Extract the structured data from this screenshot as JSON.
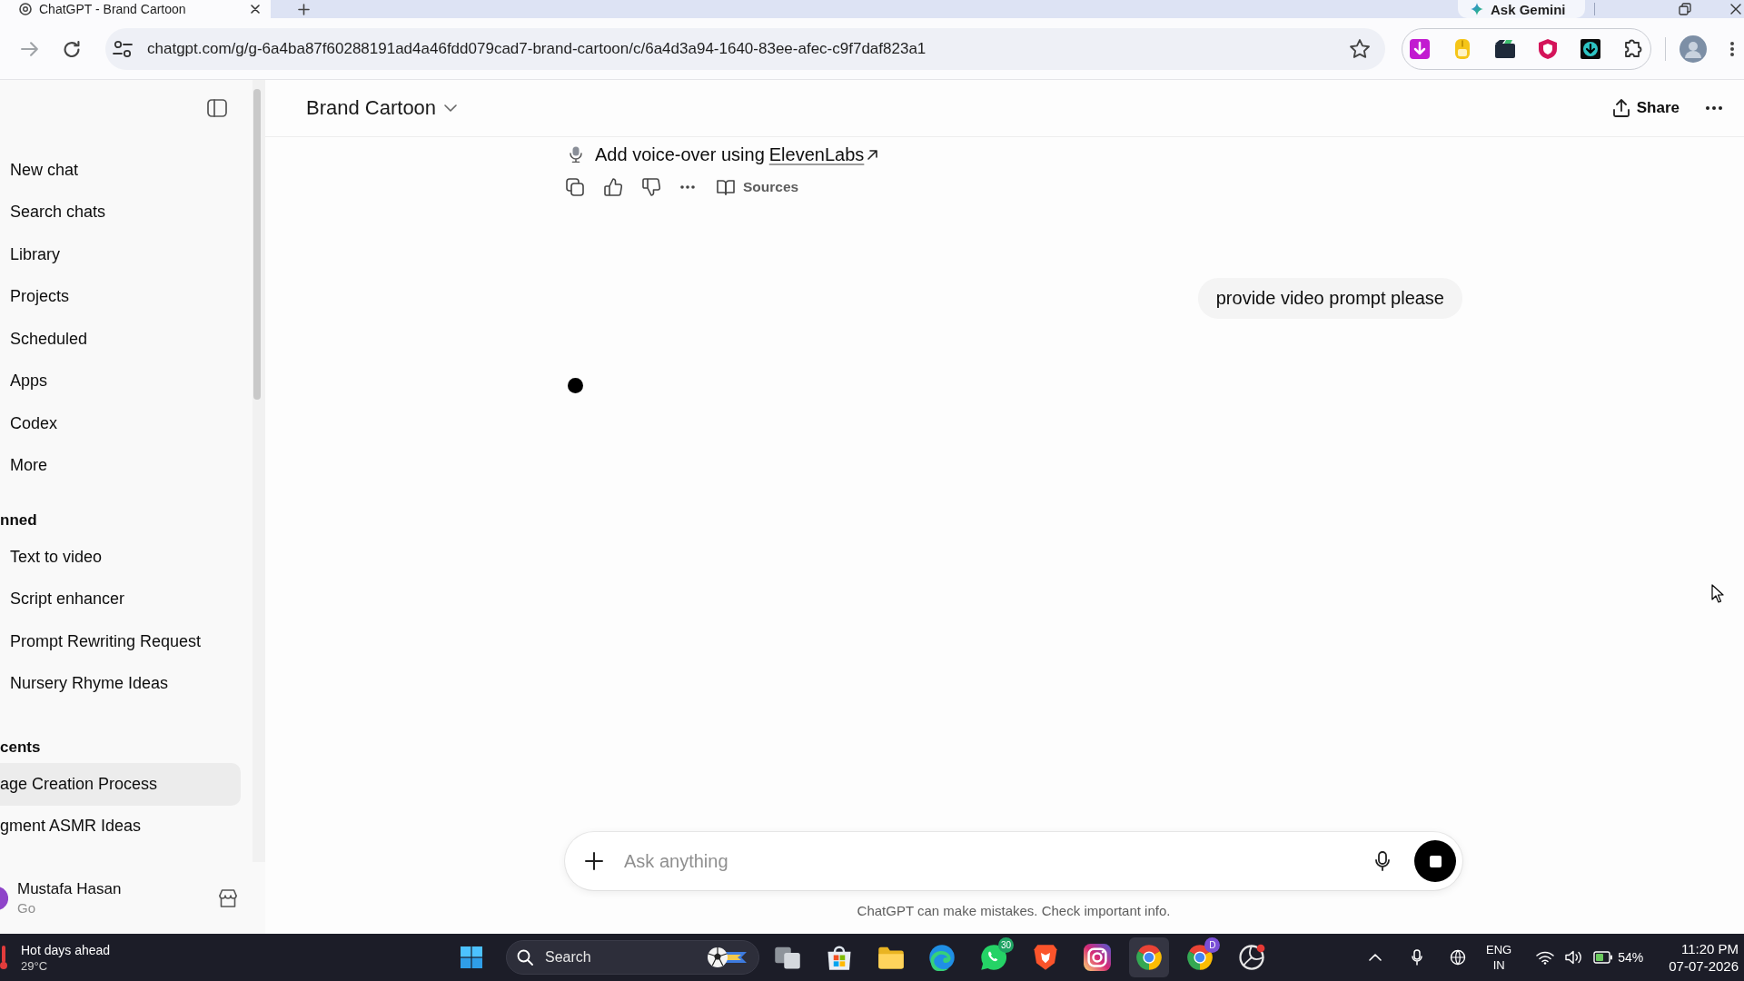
{
  "browser": {
    "tabs": [
      {
        "title": "ChatGPT - Brand Cartoon",
        "selected": true
      }
    ],
    "gemini_button": "Ask Gemini",
    "address": "chatgpt.com/g/g-6a4ba87f60288191ad4a46fdd079cad7-brand-cartoon/c/6a4d3a94-1640-83ee-afec-c9f7daf823a1"
  },
  "sidebar": {
    "nav": [
      "New chat",
      "Search chats",
      "Library",
      "Projects",
      "Scheduled",
      "Apps",
      "Codex",
      "More"
    ],
    "sections": [
      {
        "kind": "pinned",
        "heading": "nned",
        "chats": [
          {
            "title": "Text to video",
            "selected": false
          },
          {
            "title": "Script enhancer",
            "selected": false
          },
          {
            "title": "Prompt Rewriting Request",
            "selected": false
          },
          {
            "title": "Nursery Rhyme Ideas",
            "selected": false
          }
        ]
      },
      {
        "kind": "recents",
        "heading": "cents",
        "chats": [
          {
            "title": "age Creation Process",
            "selected": true
          },
          {
            "title": "gment ASMR Ideas",
            "selected": false
          }
        ]
      }
    ],
    "user": {
      "name": "Mustafa Hasan",
      "plan": "Go"
    }
  },
  "chat": {
    "title": "Brand Cartoon",
    "share": "Share",
    "assistant_line": {
      "text": "Add voice-over using",
      "link": "ElevenLabs"
    },
    "sources": "Sources",
    "user_message": "provide video prompt please",
    "composer": {
      "placeholder": "Ask anything"
    },
    "disclaimer": "ChatGPT can make mistakes. Check important info."
  },
  "taskbar": {
    "weather": {
      "headline": "Hot days ahead",
      "temperature": "29°C"
    },
    "search": {
      "placeholder": "Search"
    },
    "apps": [
      {
        "kind": "tiles",
        "selected": false
      },
      {
        "kind": "bag",
        "selected": false
      },
      {
        "kind": "folder",
        "selected": false
      },
      {
        "kind": "swirl",
        "selected": false
      },
      {
        "kind": "chat-bubble",
        "selected": false,
        "badge": {
          "text": "30",
          "color": "#1fa463"
        }
      },
      {
        "kind": "lion-shield",
        "selected": false
      },
      {
        "kind": "camera",
        "selected": false
      },
      {
        "kind": "wheel",
        "selected": true
      },
      {
        "kind": "wheel",
        "selected": false,
        "badge": {
          "text": "D",
          "color": "#7a4fd6"
        }
      },
      {
        "kind": "aperture",
        "selected": false
      }
    ],
    "tray": {
      "language": "ENG",
      "region": "IN",
      "battery": "54%",
      "time": "11:20 PM",
      "date": "07-07-2026"
    }
  }
}
